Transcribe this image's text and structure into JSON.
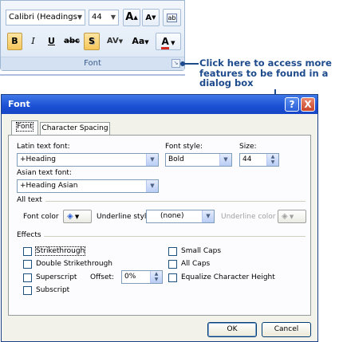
{
  "ribbon": {
    "font_name": "Calibri (Headings",
    "font_size": "44",
    "grow_font_glyph": "A",
    "shrink_font_glyph": "A",
    "clear_format_glyph": "ab",
    "bold": "B",
    "italic": "I",
    "underline": "U",
    "strike": "abc",
    "shadow": "S",
    "spacing": "AV",
    "change_case": "Aa",
    "font_color": "A",
    "group_label": "Font",
    "accent_red": "#d52b1e"
  },
  "callout": {
    "text": "Click here to access more features to be found in a dialog box",
    "color": "#1e4b8c"
  },
  "dialog": {
    "title": "Font",
    "help_label": "?",
    "close_label": "X",
    "tabs": [
      {
        "label": "Font",
        "active": true
      },
      {
        "label": "Character Spacing",
        "active": false
      }
    ],
    "latin_label": "Latin text font:",
    "latin_value": "+Heading",
    "style_label": "Font style:",
    "style_value": "Bold",
    "size_label": "Size:",
    "size_value": "44",
    "asian_label": "Asian text font:",
    "asian_value": "+Heading Asian",
    "all_text_label": "All text",
    "font_color_label": "Font color",
    "underline_style_label": "Underline style",
    "underline_style_value": "(none)",
    "underline_color_label": "Underline color",
    "effects_label": "Effects",
    "effects_left": [
      {
        "label": "Strikethrough",
        "checked": false
      },
      {
        "label": "Double Strikethrough",
        "checked": false
      },
      {
        "label": "Superscript",
        "checked": false
      },
      {
        "label": "Subscript",
        "checked": false
      }
    ],
    "offset_label": "Offset:",
    "offset_value": "0%",
    "effects_right": [
      {
        "label": "Small Caps",
        "checked": false
      },
      {
        "label": "All Caps",
        "checked": false
      },
      {
        "label": "Equalize Character Height",
        "checked": false
      }
    ],
    "ok_label": "OK",
    "cancel_label": "Cancel"
  }
}
